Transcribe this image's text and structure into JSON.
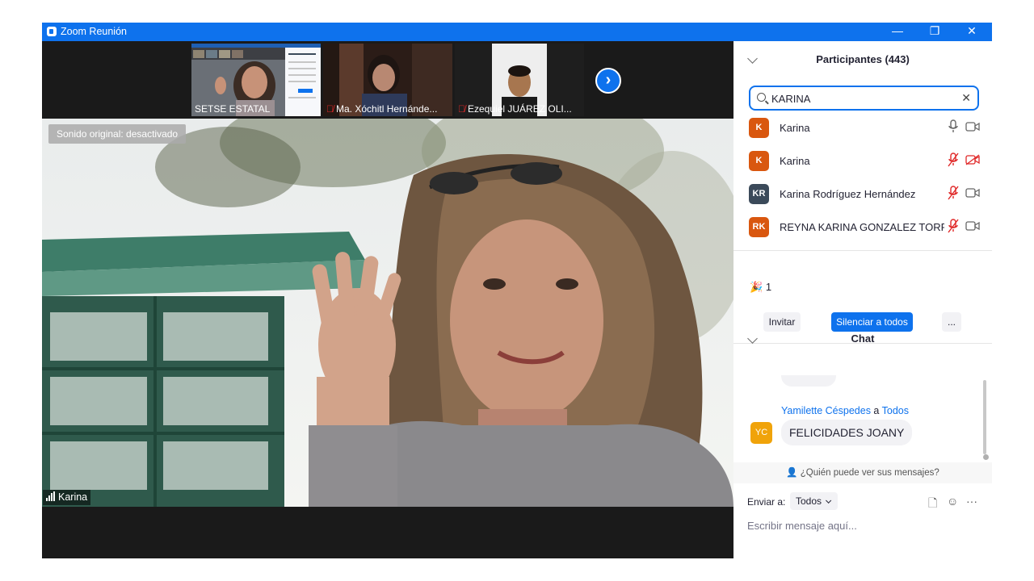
{
  "window": {
    "title": "Zoom Reunión",
    "controls": {
      "minimize": "—",
      "restore": "❐",
      "close": "✕"
    }
  },
  "thumbnails": [
    {
      "name": "SETSE ESTATAL",
      "muted": false
    },
    {
      "name": "Ma. Xóchitl Hernánde...",
      "muted": true
    },
    {
      "name": "Ezequiel JUÁREZ OLI...",
      "muted": true
    }
  ],
  "next_button": "›",
  "main_video": {
    "sound_badge": "Sonido original: desactivado",
    "speaker_name": "Karina"
  },
  "participants": {
    "title": "Participantes (443)",
    "search_value": "KARINA",
    "clear_icon": "✕",
    "list": [
      {
        "initials": "K",
        "name": "Karina",
        "avatar_color": "#d9570f",
        "mic": "on",
        "video": "off-plain"
      },
      {
        "initials": "K",
        "name": "Karina",
        "avatar_color": "#d9570f",
        "mic": "muted",
        "video": "off-red"
      },
      {
        "initials": "KR",
        "name": "Karina Rodríguez Hernández",
        "avatar_color": "#3b4a5a",
        "mic": "muted",
        "video": "off-plain"
      },
      {
        "initials": "RK",
        "name": "REYNA KARINA GONZALEZ TORR...",
        "avatar_color": "#d9570f",
        "mic": "muted",
        "video": "off-plain"
      }
    ],
    "reaction_count": "1",
    "invite_label": "Invitar",
    "mute_all_label": "Silenciar a todos",
    "more_label": "..."
  },
  "chat": {
    "title": "Chat",
    "message": {
      "sender": "Yamilette Céspedes",
      "connector": "a",
      "recipient": "Todos",
      "initials": "YC",
      "text": "FELICIDADES JOANY"
    },
    "privacy_text": "¿Quién puede ver sus mensajes?",
    "send_to_label": "Enviar a:",
    "send_to_value": "Todos",
    "input_placeholder": "Escribir mensaje aquí..."
  },
  "colors": {
    "accent": "#0e72ed",
    "muted_red": "#e02828",
    "avatar_orange": "#d9570f",
    "avatar_slate": "#3b4a5a",
    "avatar_yellow": "#f0a30a"
  }
}
